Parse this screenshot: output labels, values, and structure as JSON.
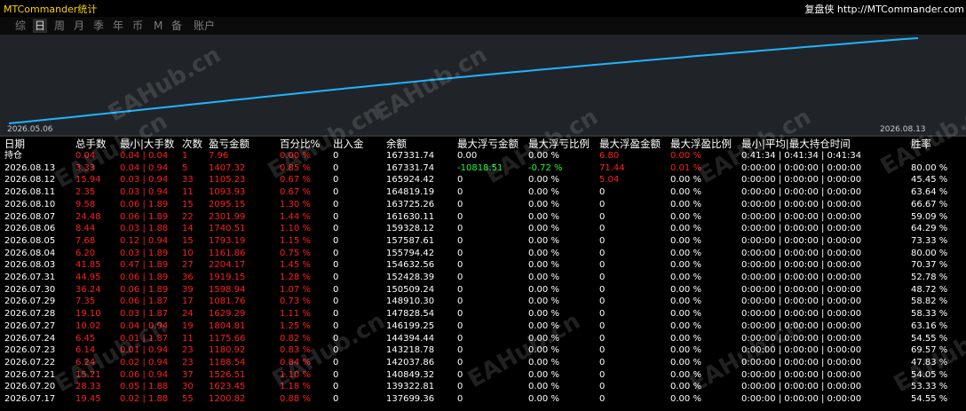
{
  "app_title": "MTCommander统计",
  "brand": "复盘侠 http://MTCommander.com",
  "tabs": [
    "综",
    "日",
    "周",
    "月",
    "季",
    "年",
    "币",
    "M",
    "备",
    "账户"
  ],
  "active_tab": 1,
  "chart": {
    "start_label": "2026.05.06",
    "end_label": "2026.08.13",
    "line_color": "#1fb4ff"
  },
  "watermark": "EAHub.cn",
  "table": {
    "headers": {
      "date": "日期",
      "lots": "总手数",
      "minmax": "最小|大手数",
      "count": "次数",
      "pnl": "盈亏金额",
      "pct": "百分比%",
      "io": "出入金",
      "balance": "余额",
      "max_float_loss": "最大浮亏金额",
      "max_float_loss_pct": "最大浮亏比例",
      "max_float_profit": "最大浮盈金额",
      "max_float_profit_pct": "最大浮盈比例",
      "hold_time": "最小|平均|最大持仓时间",
      "winrate": "胜率"
    },
    "rows": [
      {
        "date": "持仓",
        "lots": "0.04",
        "minmax": "0.04 | 0.04",
        "count": "1",
        "pnl": "7.96",
        "pct": "0.00 %",
        "io": "0",
        "balance": "167331.74",
        "fl": "0.00",
        "flp": "0.00 %",
        "fp": "6.80",
        "fpp": "0.00 %",
        "time": "0:41:34 | 0:41:34 | 0:41:34",
        "win": "",
        "fl_color": "",
        "flp_color": "",
        "fp_color": "red",
        "fpp_color": "red"
      },
      {
        "date": "2026.08.13",
        "lots": "3.33",
        "minmax": "0.04 | 0.94",
        "count": "5",
        "pnl": "1407.32",
        "pct": "0.85 %",
        "io": "0",
        "balance": "167331.74",
        "fl": "-10818.51",
        "flp": "-0.72 %",
        "fp": "71.44",
        "fpp": "0.01 %",
        "time": "0:00:00 | 0:00:00 | 0:00:00",
        "win": "80.00 %",
        "fl_color": "green",
        "flp_color": "green",
        "fp_color": "red",
        "fpp_color": "red"
      },
      {
        "date": "2026.08.12",
        "lots": "15.94",
        "minmax": "0.03 | 0.94",
        "count": "33",
        "pnl": "1105.23",
        "pct": "0.67 %",
        "io": "0",
        "balance": "165924.42",
        "fl": "0",
        "flp": "0.00 %",
        "fp": "5.04",
        "fpp": "0.00 %",
        "time": "0:00:00 | 0:00:00 | 0:00:00",
        "win": "45.45 %",
        "fl_color": "",
        "flp_color": "",
        "fp_color": "red",
        "fpp_color": ""
      },
      {
        "date": "2026.08.11",
        "lots": "2.35",
        "minmax": "0.03 | 0.94",
        "count": "11",
        "pnl": "1093.93",
        "pct": "0.67 %",
        "io": "0",
        "balance": "164819.19",
        "fl": "0",
        "flp": "0.00 %",
        "fp": "0",
        "fpp": "0.00 %",
        "time": "0:00:00 | 0:00:00 | 0:00:00",
        "win": "63.64 %"
      },
      {
        "date": "2026.08.10",
        "lots": "9.58",
        "minmax": "0.06 | 1.89",
        "count": "15",
        "pnl": "2095.15",
        "pct": "1.30 %",
        "io": "0",
        "balance": "163725.26",
        "fl": "0",
        "flp": "0.00 %",
        "fp": "0",
        "fpp": "0.00 %",
        "time": "0:00:00 | 0:00:00 | 0:00:00",
        "win": "66.67 %"
      },
      {
        "date": "2026.08.07",
        "lots": "24.48",
        "minmax": "0.06 | 1.89",
        "count": "22",
        "pnl": "2301.99",
        "pct": "1.44 %",
        "io": "0",
        "balance": "161630.11",
        "fl": "0",
        "flp": "0.00 %",
        "fp": "0",
        "fpp": "0.00 %",
        "time": "0:00:00 | 0:00:00 | 0:00:00",
        "win": "59.09 %"
      },
      {
        "date": "2026.08.06",
        "lots": "8.44",
        "minmax": "0.03 | 1.88",
        "count": "14",
        "pnl": "1740.51",
        "pct": "1.10 %",
        "io": "0",
        "balance": "159328.12",
        "fl": "0",
        "flp": "0.00 %",
        "fp": "0",
        "fpp": "0.00 %",
        "time": "0:00:00 | 0:00:00 | 0:00:00",
        "win": "64.29 %"
      },
      {
        "date": "2026.08.05",
        "lots": "7.68",
        "minmax": "0.12 | 0.94",
        "count": "15",
        "pnl": "1793.19",
        "pct": "1.15 %",
        "io": "0",
        "balance": "157587.61",
        "fl": "0",
        "flp": "0.00 %",
        "fp": "0",
        "fpp": "0.00 %",
        "time": "0:00:00 | 0:00:00 | 0:00:00",
        "win": "73.33 %"
      },
      {
        "date": "2026.08.04",
        "lots": "6.20",
        "minmax": "0.03 | 1.89",
        "count": "10",
        "pnl": "1161.86",
        "pct": "0.75 %",
        "io": "0",
        "balance": "155794.42",
        "fl": "0",
        "flp": "0.00 %",
        "fp": "0",
        "fpp": "0.00 %",
        "time": "0:00:00 | 0:00:00 | 0:00:00",
        "win": "80.00 %"
      },
      {
        "date": "2026.08.03",
        "lots": "41.85",
        "minmax": "0.47 | 1.89",
        "count": "27",
        "pnl": "2204.17",
        "pct": "1.45 %",
        "io": "0",
        "balance": "154632.56",
        "fl": "0",
        "flp": "0.00 %",
        "fp": "0",
        "fpp": "0.00 %",
        "time": "0:00:00 | 0:00:00 | 0:00:00",
        "win": "70.37 %"
      },
      {
        "date": "2026.07.31",
        "lots": "44.95",
        "minmax": "0.06 | 1.89",
        "count": "36",
        "pnl": "1919.15",
        "pct": "1.28 %",
        "io": "0",
        "balance": "152428.39",
        "fl": "0",
        "flp": "0.00 %",
        "fp": "0",
        "fpp": "0.00 %",
        "time": "0:00:00 | 0:00:00 | 0:00:00",
        "win": "52.78 %"
      },
      {
        "date": "2026.07.30",
        "lots": "36.24",
        "minmax": "0.06 | 1.89",
        "count": "39",
        "pnl": "1598.94",
        "pct": "1.07 %",
        "io": "0",
        "balance": "150509.24",
        "fl": "0",
        "flp": "0.00 %",
        "fp": "0",
        "fpp": "0.00 %",
        "time": "0:00:00 | 0:00:00 | 0:00:00",
        "win": "48.72 %"
      },
      {
        "date": "2026.07.29",
        "lots": "7.35",
        "minmax": "0.06 | 1.87",
        "count": "17",
        "pnl": "1081.76",
        "pct": "0.73 %",
        "io": "0",
        "balance": "148910.30",
        "fl": "0",
        "flp": "0.00 %",
        "fp": "0",
        "fpp": "0.00 %",
        "time": "0:00:00 | 0:00:00 | 0:00:00",
        "win": "58.82 %"
      },
      {
        "date": "2026.07.28",
        "lots": "19.10",
        "minmax": "0.03 | 1.87",
        "count": "24",
        "pnl": "1629.29",
        "pct": "1.11 %",
        "io": "0",
        "balance": "147828.54",
        "fl": "0",
        "flp": "0.00 %",
        "fp": "0",
        "fpp": "0.00 %",
        "time": "0:00:00 | 0:00:00 | 0:00:00",
        "win": "58.33 %"
      },
      {
        "date": "2026.07.27",
        "lots": "10.02",
        "minmax": "0.04 | 0.94",
        "count": "19",
        "pnl": "1804.81",
        "pct": "1.25 %",
        "io": "0",
        "balance": "146199.25",
        "fl": "0",
        "flp": "0.00 %",
        "fp": "0",
        "fpp": "0.00 %",
        "time": "0:00:00 | 0:00:00 | 0:00:00",
        "win": "63.16 %"
      },
      {
        "date": "2026.07.24",
        "lots": "6.45",
        "minmax": "0.01 | 1.87",
        "count": "11",
        "pnl": "1175.66",
        "pct": "0.82 %",
        "io": "0",
        "balance": "144394.44",
        "fl": "0",
        "flp": "0.00 %",
        "fp": "0",
        "fpp": "0.00 %",
        "time": "0:00:00 | 0:00:00 | 0:00:00",
        "win": "54.55 %"
      },
      {
        "date": "2026.07.23",
        "lots": "6.14",
        "minmax": "0.01 | 0.94",
        "count": "23",
        "pnl": "1180.92",
        "pct": "0.83 %",
        "io": "0",
        "balance": "143218.78",
        "fl": "0",
        "flp": "0.00 %",
        "fp": "0",
        "fpp": "0.00 %",
        "time": "0:00:00 | 0:00:00 | 0:00:00",
        "win": "69.57 %"
      },
      {
        "date": "2026.07.22",
        "lots": "6.24",
        "minmax": "0.02 | 0.94",
        "count": "23",
        "pnl": "1188.54",
        "pct": "0.84 %",
        "io": "0",
        "balance": "142037.86",
        "fl": "0",
        "flp": "0.00 %",
        "fp": "0",
        "fpp": "0.00 %",
        "time": "0:00:00 | 0:00:00 | 0:00:00",
        "win": "47.83 %"
      },
      {
        "date": "2026.07.21",
        "lots": "15.21",
        "minmax": "0.06 | 0.94",
        "count": "37",
        "pnl": "1526.51",
        "pct": "1.10 %",
        "io": "0",
        "balance": "140849.32",
        "fl": "0",
        "flp": "0.00 %",
        "fp": "0",
        "fpp": "0.00 %",
        "time": "0:00:00 | 0:00:00 | 0:00:00",
        "win": "54.05 %"
      },
      {
        "date": "2026.07.20",
        "lots": "28.33",
        "minmax": "0.05 | 1.88",
        "count": "30",
        "pnl": "1623.45",
        "pct": "1.18 %",
        "io": "0",
        "balance": "139322.81",
        "fl": "0",
        "flp": "0.00 %",
        "fp": "0",
        "fpp": "0.00 %",
        "time": "0:00:00 | 0:00:00 | 0:00:00",
        "win": "53.33 %"
      },
      {
        "date": "2026.07.17",
        "lots": "19.45",
        "minmax": "0.02 | 1.88",
        "count": "55",
        "pnl": "1200.82",
        "pct": "0.88 %",
        "io": "0",
        "balance": "137699.36",
        "fl": "0",
        "flp": "0.00 %",
        "fp": "0",
        "fpp": "0.00 %",
        "time": "0:00:00 | 0:00:00 | 0:00:00",
        "win": "54.55 %"
      }
    ]
  }
}
